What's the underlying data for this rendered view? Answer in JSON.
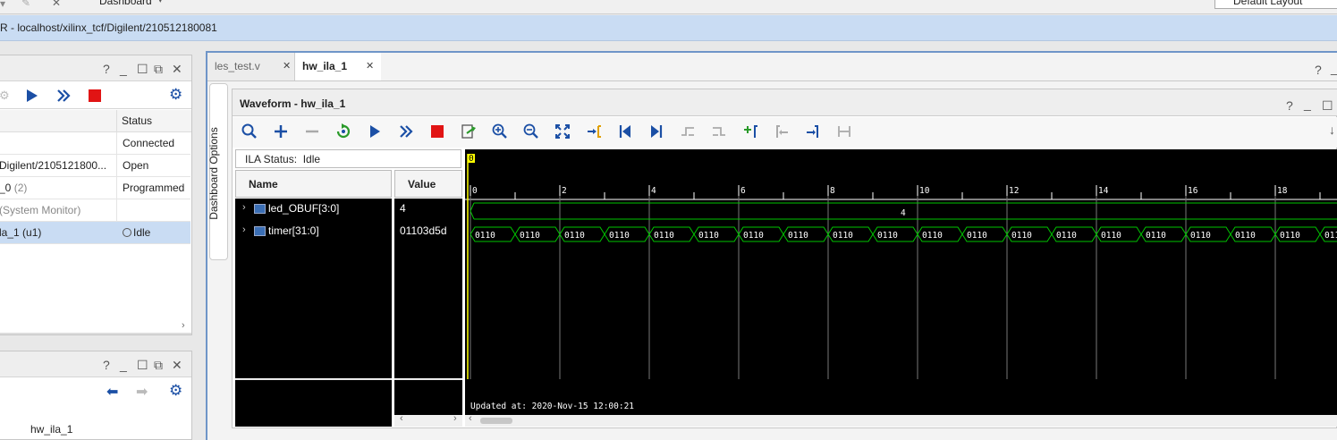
{
  "top": {
    "toolbar_text": "Dashboard",
    "layout_select": "Default Layout"
  },
  "path_bar": {
    "text": "R - localhost/xilinx_tcf/Digilent/210512180081"
  },
  "hardware_panel": {
    "col_status": "Status",
    "rows": [
      {
        "name": "",
        "status": "Connected"
      },
      {
        "name": "Digilent/2105121800...",
        "status": "Open"
      },
      {
        "name": "_0",
        "name_suffix": "(2)",
        "status": "Programmed"
      },
      {
        "name": "(System Monitor)",
        "status": ""
      },
      {
        "name": "la_1 (u1)",
        "status": "Idle",
        "selected": true
      }
    ]
  },
  "properties_panel": {
    "item": "hw_ila_1"
  },
  "tabs": [
    {
      "label": "les_test.v",
      "active": false
    },
    {
      "label": "hw_ila_1",
      "active": true
    }
  ],
  "side_tab": "Dashboard Options",
  "waveform": {
    "title": "Waveform - hw_ila_1",
    "ila_status": "ILA Status:  Idle",
    "col_name": "Name",
    "col_value": "Value",
    "marker_label": "0",
    "signals": [
      {
        "name": "led_OBUF[3:0]",
        "value": "4",
        "wave_label": "4"
      },
      {
        "name": "timer[31:0]",
        "value": "01103d5d",
        "wave_label": "0110"
      }
    ],
    "ticks": [
      "0",
      "2",
      "4",
      "6",
      "8",
      "10",
      "12",
      "14",
      "16",
      "18"
    ],
    "updated": "Updated at: 2020-Nov-15 12:00:21"
  },
  "colors": {
    "accent": "#6f95c8",
    "wave_green": "#00c400",
    "stop_red": "#e11414",
    "play_blue": "#1b4fa5",
    "marker_yellow": "#ffff00",
    "selection": "#c9dcf3"
  }
}
